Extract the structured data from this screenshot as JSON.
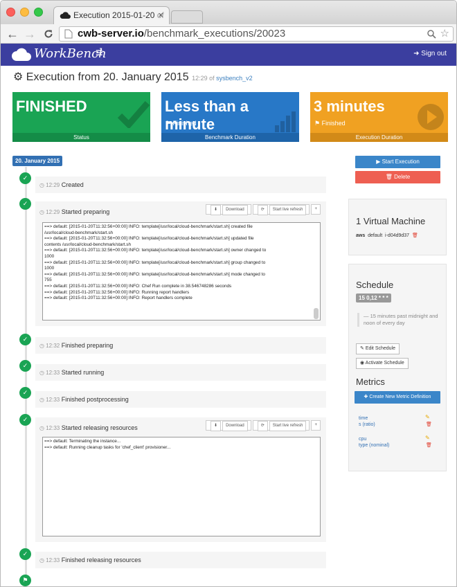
{
  "browser": {
    "tab_title_main": "Execution 2015-01-20",
    "tab_title_fade": " of",
    "tab_close": "×",
    "url_host": "cwb-server.io",
    "url_path": "/benchmark_executions/20023"
  },
  "navbar": {
    "brand": "WorkBench",
    "menu": "≡",
    "signout": "Sign out"
  },
  "page": {
    "title": "Execution from 20. January 2015",
    "time": "12:29",
    "of": "of",
    "benchmark": "sysbench_v2"
  },
  "tiles": [
    {
      "big": "FINISHED",
      "small": "",
      "foot": "Status",
      "color": "#1aa454",
      "foot_color": "#148c47"
    },
    {
      "big": "Less than a minute",
      "small": "Finished",
      "foot": "Benchmark Duration",
      "color": "#2878c7",
      "foot_color": "#1e64a9"
    },
    {
      "big": "3 minutes",
      "small": "Finished",
      "foot": "Execution Duration",
      "color": "#f0a122",
      "foot_color": "#d28a18"
    }
  ],
  "timeline": {
    "date": "20. January 2015",
    "events": [
      {
        "time": "12:29",
        "label": "Created"
      },
      {
        "time": "12:29",
        "label": "Started preparing"
      },
      {
        "time": "12:32",
        "label": "Finished preparing"
      },
      {
        "time": "12:33",
        "label": "Started running"
      },
      {
        "time": "12:33",
        "label": "Finished postprocessing"
      },
      {
        "time": "12:33",
        "label": "Started releasing resources"
      },
      {
        "time": "12:33",
        "label": "Finished releasing resources"
      }
    ],
    "download_label": "Download",
    "live_refresh_label": "Start live refresh",
    "plus_label": "+",
    "log_preparing": [
      "==> default: [2015-01-20T11:32:56+00:00] INFO: template[/usr/local/cloud-benchmark/start.sh] created file",
      "/usr/local/cloud-benchmark/start.sh",
      "==> default: [2015-01-20T11:32:56+00:00] INFO: template[/usr/local/cloud-benchmark/start.sh] updated file",
      "contents /usr/local/cloud-benchmark/start.sh",
      "==> default: [2015-01-20T11:32:56+00:00] INFO: template[/usr/local/cloud-benchmark/start.sh] owner changed to",
      "1000",
      "==> default: [2015-01-20T11:32:56+00:00] INFO: template[/usr/local/cloud-benchmark/start.sh] group changed to",
      "1000",
      "==> default: [2015-01-20T11:32:56+00:00] INFO: template[/usr/local/cloud-benchmark/start.sh] mode changed to",
      "755",
      "==> default: [2015-01-20T11:32:56+00:00] INFO: Chef Run complete in 38.546748286 seconds",
      "==> default: [2015-01-20T11:32:56+00:00] INFO: Running report handlers",
      "==> default: [2015-01-20T11:32:56+00:00] INFO: Report handlers complete"
    ],
    "log_releasing": [
      "==> default: Terminating the instance...",
      "==> default: Running cleanup tasks for 'chef_client' provisioner..."
    ]
  },
  "actions": {
    "start_execution": "Start Execution",
    "delete": "Delete"
  },
  "vm_panel": {
    "title": "1 Virtual Machine",
    "provider": "aws",
    "role": "default",
    "instance": "i-d04d9d37"
  },
  "schedule_panel": {
    "title": "Schedule",
    "cron": "15 0,12 * * *",
    "description": "— 15 minutes past midnight and noon of every day",
    "edit_label": "Edit Schedule",
    "activate_label": "Activate Schedule",
    "metrics_title": "Metrics",
    "create_metric_label": "Create New Metric Definition",
    "metrics": [
      {
        "name": "time",
        "type": "s (ratio)"
      },
      {
        "name": "cpu",
        "type": "type (nominal)"
      }
    ]
  }
}
